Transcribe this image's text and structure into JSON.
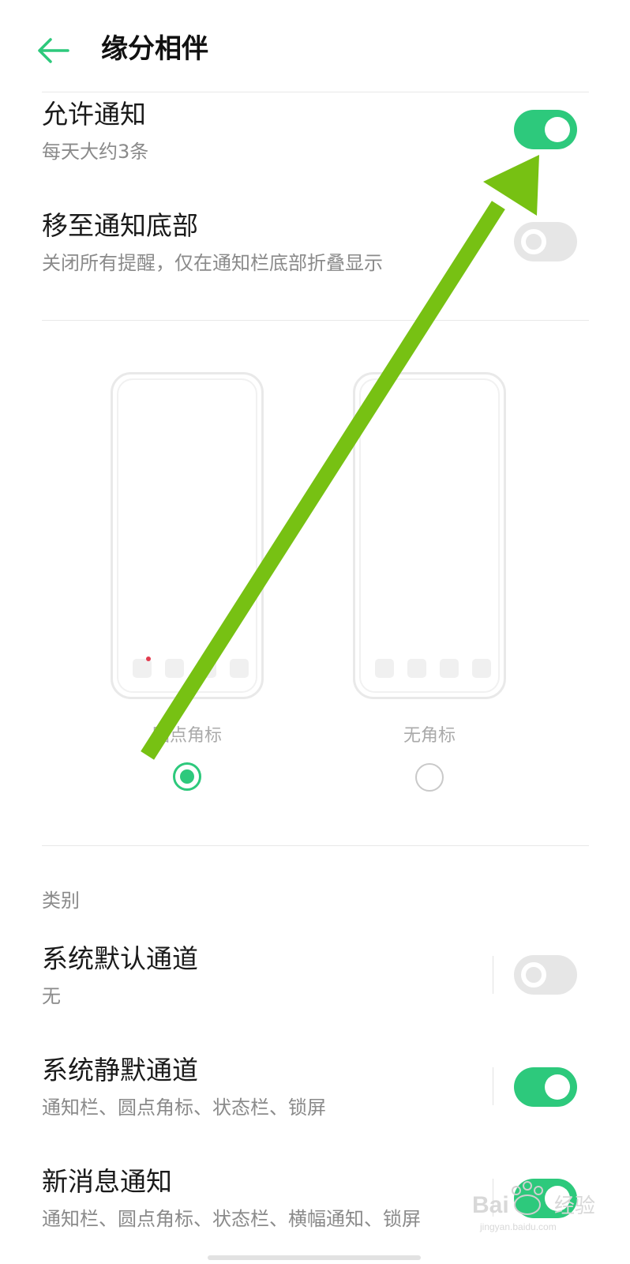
{
  "header": {
    "back_icon": "arrow-left-icon",
    "title": "缘分相伴"
  },
  "notifications": {
    "allow": {
      "title": "允许通知",
      "subtitle": "每天大约3条",
      "enabled": true
    },
    "move_bottom": {
      "title": "移至通知底部",
      "subtitle": "关闭所有提醒，仅在通知栏底部折叠显示",
      "enabled": false
    }
  },
  "badge_style": {
    "options": [
      {
        "label": "圆点角标",
        "selected": true
      },
      {
        "label": "无角标",
        "selected": false
      }
    ]
  },
  "categories": {
    "label": "类别",
    "items": [
      {
        "title": "系统默认通道",
        "subtitle": "无",
        "enabled": false
      },
      {
        "title": "系统静默通道",
        "subtitle": "通知栏、圆点角标、状态栏、锁屏",
        "enabled": true
      },
      {
        "title": "新消息通知",
        "subtitle": "通知栏、圆点角标、状态栏、横幅通知、锁屏",
        "enabled": true
      }
    ]
  },
  "overlay": {
    "arrow_color": "#77c113",
    "watermark_text": "Baidu经验",
    "watermark_url": "jingyan.baidu.com"
  },
  "colors": {
    "accent": "#2dc97c",
    "badge_dot": "#e23b4e"
  }
}
